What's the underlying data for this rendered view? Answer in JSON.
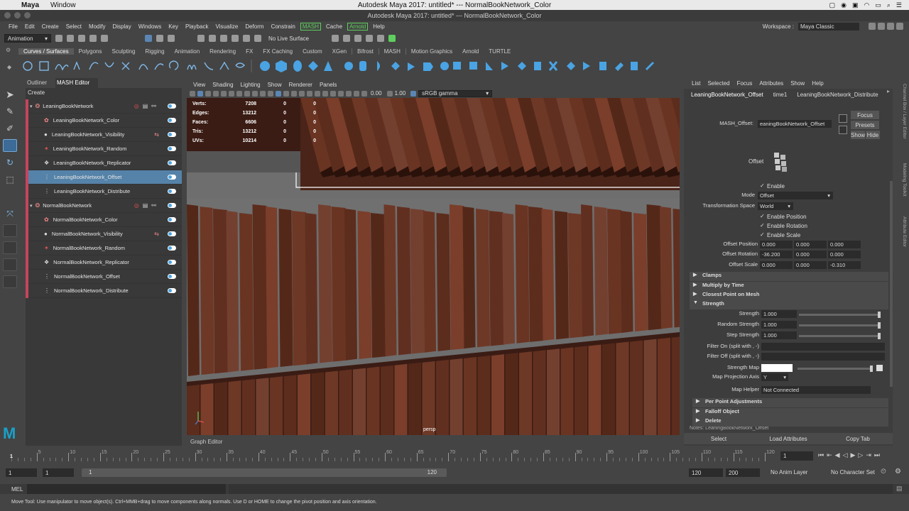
{
  "mac": {
    "apple": "",
    "app": "Maya",
    "window": "Window",
    "title": "Autodesk Maya 2017: untitled*   ---   NormalBookNetwork_Color"
  },
  "menus": [
    "File",
    "Edit",
    "Create",
    "Select",
    "Modify",
    "Display",
    "Windows",
    "Key",
    "Playback",
    "Visualize",
    "Deform",
    "Constrain"
  ],
  "menus_after": [
    "Cache"
  ],
  "menus_end": [
    "Help"
  ],
  "menu_mash": "MASH",
  "menu_arnold": "Arnold",
  "workspace": {
    "label": "Workspace :",
    "value": "Maya Classic"
  },
  "status": {
    "mode": "Animation",
    "live_surface": "No Live Surface"
  },
  "shelf_tabs": [
    "Curves / Surfaces",
    "Polygons",
    "Sculpting",
    "Rigging",
    "Animation",
    "Rendering",
    "FX",
    "FX Caching",
    "Custom",
    "XGen",
    "Bifrost",
    "MASH",
    "Motion Graphics",
    "Arnold",
    "TURTLE"
  ],
  "outliner": {
    "tabs": [
      "Outliner",
      "MASH Editor"
    ],
    "create": "Create",
    "networks": [
      {
        "name": "LeaningBookNetwork",
        "nodes": [
          "LeaningBookNetwork_Color",
          "LeaningBookNetwork_Visibility",
          "LeaningBookNetwork_Random",
          "LeaningBookNetwork_Replicator",
          "LeaningBookNetwork_Offset",
          "LeaningBookNetwork_Distribute"
        ]
      },
      {
        "name": "NormalBookNetwork",
        "nodes": [
          "NormalBookNetwork_Color",
          "NormalBookNetwork_Visibility",
          "NormalBookNetwork_Random",
          "NormalBookNetwork_Replicator",
          "NormalBookNetwork_Offset",
          "NormalBookNetwork_Distribute"
        ]
      }
    ]
  },
  "viewport": {
    "menu": [
      "View",
      "Shading",
      "Lighting",
      "Show",
      "Renderer",
      "Panels"
    ],
    "val1": "0.00",
    "val2": "1.00",
    "colorspace": "sRGB gamma",
    "hud": [
      {
        "k": "Verts:",
        "v": "7208",
        "a": "0",
        "b": "0"
      },
      {
        "k": "Edges:",
        "v": "13212",
        "a": "0",
        "b": "0"
      },
      {
        "k": "Faces:",
        "v": "6606",
        "a": "0",
        "b": "0"
      },
      {
        "k": "Tris:",
        "v": "13212",
        "a": "0",
        "b": "0"
      },
      {
        "k": "UVs:",
        "v": "10214",
        "a": "0",
        "b": "0"
      }
    ],
    "camera": "persp"
  },
  "graph_editor": "Graph Editor",
  "ae": {
    "menu": [
      "List",
      "Selected",
      "Focus",
      "Attributes",
      "Show",
      "Help"
    ],
    "tabs": [
      "LeaningBookNetwork_Offset",
      "time1",
      "LeaningBookNetwork_Distribute"
    ],
    "node_label": "MASH_Offset:",
    "node_value": "eaningBookNetwork_Offset",
    "focus": "Focus",
    "presets": "Presets",
    "show": "Show",
    "hide": "Hide",
    "section_title": "Offset",
    "enable": "Enable",
    "mode_label": "Mode",
    "mode_value": "Offset",
    "tspace_label": "Transformation Space",
    "tspace_value": "World",
    "enable_position": "Enable Position",
    "enable_rotation": "Enable Rotation",
    "enable_scale": "Enable Scale",
    "offset_position_label": "Offset Position",
    "offset_position": [
      "0.000",
      "0.000",
      "0.000"
    ],
    "offset_rotation_label": "Offset Rotation",
    "offset_rotation": [
      "-36.200",
      "0.000",
      "0.000"
    ],
    "offset_scale_label": "Offset Scale",
    "offset_scale": [
      "0.000",
      "0.000",
      "-0.310"
    ],
    "sections": [
      "Clamps",
      "Multiply by Time",
      "Closest Point on Mesh",
      "Strength"
    ],
    "strength_label": "Strength",
    "strength": "1.000",
    "random_strength_label": "Random Strength",
    "random_strength": "1.000",
    "step_strength_label": "Step Strength",
    "step_strength": "1.000",
    "filter_on": "Filter On (split with , -)",
    "filter_off": "Filter Off (split with , -)",
    "strength_map": "Strength Map",
    "map_axis_label": "Map Projection Axis",
    "map_axis": "Y",
    "map_helper_label": "Map Helper",
    "map_helper": "Not Connected",
    "sections2": [
      "Per Point Adjustments",
      "Falloff Object",
      "Delete"
    ],
    "notes": "Notes:  LeaningBookNetwork_Offset",
    "bottom": [
      "Select",
      "Load Attributes",
      "Copy Tab"
    ]
  },
  "right_strip": [
    "Channel Box / Layer Editor",
    "Modeling Toolkit",
    "Attribute Editor"
  ],
  "timeline": {
    "ticks": [
      5,
      10,
      15,
      20,
      25,
      30,
      35,
      40,
      45,
      50,
      55,
      60,
      65,
      70,
      75,
      80,
      85,
      90,
      95,
      100,
      105,
      110,
      115,
      120
    ],
    "current": "1",
    "frame_field": "1"
  },
  "range": {
    "start": "1",
    "start2": "1",
    "slider_start": "1",
    "slider_end": "120",
    "end": "120",
    "end2": "200",
    "anim_layer": "No Anim Layer",
    "char_set": "No Character Set"
  },
  "mel": "MEL",
  "help": "Move Tool: Use manipulator to move object(s). Ctrl+MMB+drag to move components along normals. Use D or HOME to change the pivot position and axis orientation."
}
